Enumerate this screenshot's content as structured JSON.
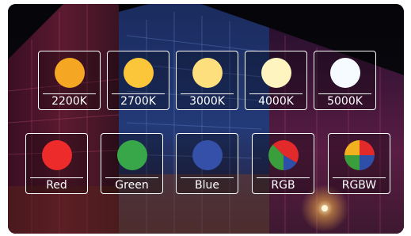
{
  "swatches": {
    "row1": [
      {
        "label": "2200K",
        "color": "#f5a623",
        "kind": "solid"
      },
      {
        "label": "2700K",
        "color": "#fcc63a",
        "kind": "solid"
      },
      {
        "label": "3000K",
        "color": "#fde07d",
        "kind": "solid"
      },
      {
        "label": "4000K",
        "color": "#fef4bf",
        "kind": "solid"
      },
      {
        "label": "5000K",
        "color": "#f6fbff",
        "kind": "solid"
      }
    ],
    "row2": [
      {
        "label": "Red",
        "color": "#ee2b2b",
        "kind": "solid"
      },
      {
        "label": "Green",
        "color": "#37a74a",
        "kind": "solid"
      },
      {
        "label": "Blue",
        "color": "#3550a8",
        "kind": "solid"
      },
      {
        "label": "RGB",
        "colors": [
          "#e22a2a",
          "#3a9e3c",
          "#2e4fa8"
        ],
        "kind": "rgb"
      },
      {
        "label": "RGBW",
        "colors": [
          "#f2b21f",
          "#e22a2a",
          "#2e4fa8",
          "#3a9e3c"
        ],
        "kind": "rgbw"
      }
    ]
  }
}
